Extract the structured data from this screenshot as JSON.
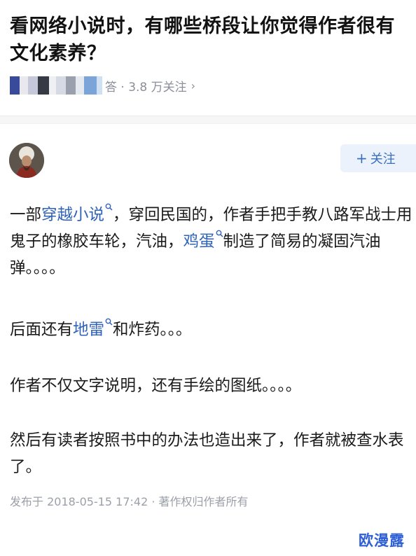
{
  "question": {
    "title": "看网络小说时，有哪些桥段让你觉得作者很有文化素养？",
    "meta_text": "答 · 3.8 万关注",
    "chevron": "›"
  },
  "author": {
    "follow_label": "关注",
    "follow_plus": "+"
  },
  "answer": {
    "p1": [
      {
        "t": "一部",
        "link": false
      },
      {
        "t": "穿越小说",
        "link": true
      },
      {
        "t": "，穿回民国的，作者手把手教八路军战士用鬼子的橡胶车轮，汽油，",
        "link": false
      },
      {
        "t": "鸡蛋",
        "link": true
      },
      {
        "t": "制造了简易的凝固汽油弹。。。。",
        "link": false
      }
    ],
    "p2": [
      {
        "t": "后面还有",
        "link": false
      },
      {
        "t": "地雷",
        "link": true
      },
      {
        "t": "和炸药。。。",
        "link": false
      }
    ],
    "p3": "作者不仅文字说明，还有手绘的图纸。。。。",
    "p4": "然后有读者按照书中的办法也造出来了，作者就被查水表了。"
  },
  "footer": {
    "meta": "发布于 2018-05-15 17:42 · 著作权归作者所有"
  },
  "watermark": "欧漫露",
  "colors": {
    "link": "#2f63ba",
    "follow_bg": "#ebf2fb",
    "meta_gray": "#8a8f99",
    "watermark": "#2e5fd4"
  }
}
